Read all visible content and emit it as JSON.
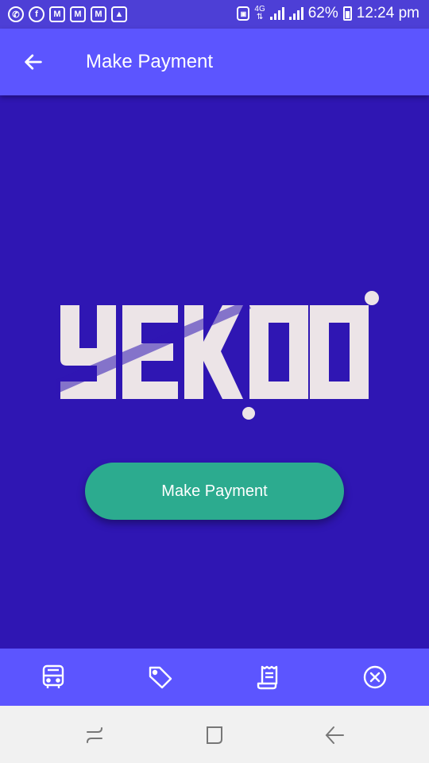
{
  "status_bar": {
    "battery": "62%",
    "time": "12:24 pm",
    "network": "4G",
    "notification_icons": [
      "whatsapp-icon",
      "facebook-icon",
      "gmail-icon",
      "gmail-icon",
      "gmail-icon",
      "gallery-icon"
    ]
  },
  "app_bar": {
    "title": "Make Payment"
  },
  "logo": {
    "text": "YEKOO"
  },
  "main": {
    "pay_button_label": "Make Payment"
  },
  "bottom_nav": {
    "items": [
      "bus-icon",
      "tag-icon",
      "receipt-icon",
      "close-circle-icon"
    ]
  },
  "colors": {
    "background": "#2f16b3",
    "app_bar": "#5c55ff",
    "button": "#2cab8f",
    "logo": "#ece4e7"
  }
}
